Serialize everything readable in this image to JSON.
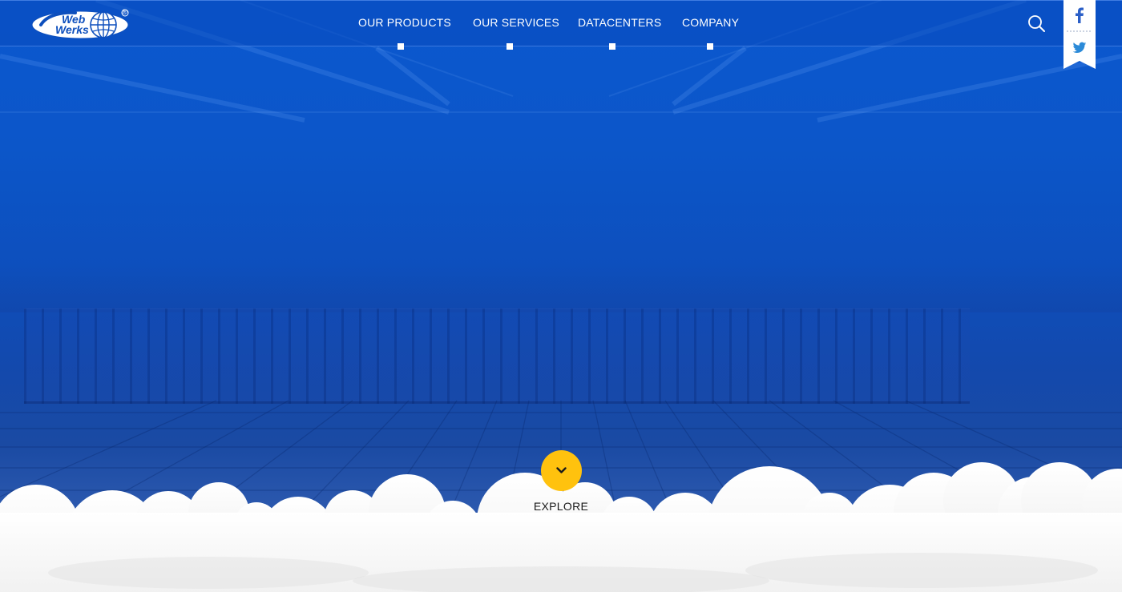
{
  "brand": {
    "logo_line1": "Web",
    "logo_line2": "Werks",
    "registered_mark": "®",
    "logo_icon": "globe-icon"
  },
  "nav": {
    "items": [
      {
        "label": "OUR PRODUCTS"
      },
      {
        "label": "OUR SERVICES"
      },
      {
        "label": "DATACENTERS"
      },
      {
        "label": "COMPANY"
      }
    ]
  },
  "header": {
    "search_icon": "search-icon"
  },
  "social": {
    "facebook_icon": "facebook-icon",
    "twitter_icon": "twitter-icon"
  },
  "hero": {
    "explore_label": "EXPLORE",
    "explore_icon": "chevron-down-icon"
  },
  "colors": {
    "hero_blue": "#0c56c9",
    "explore_yellow": "#ffc20e",
    "cloud_white": "#f7f7f7",
    "social_ribbon": "#ffffff"
  }
}
